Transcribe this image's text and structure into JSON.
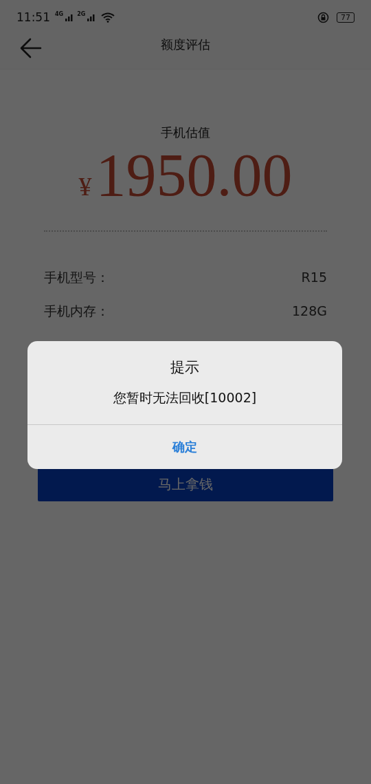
{
  "status_bar": {
    "time": "11:51",
    "signal_1": "4G",
    "signal_2": "2G",
    "battery": "77"
  },
  "header": {
    "title": "额度评估"
  },
  "valuation": {
    "label": "手机估值",
    "currency": "¥",
    "amount": "1950.00"
  },
  "specs": [
    {
      "label": "手机型号：",
      "value": "R15"
    },
    {
      "label": "手机内存：",
      "value": "128G"
    }
  ],
  "submit_button": {
    "label": "马上拿钱"
  },
  "dialog": {
    "title": "提示",
    "message": "您暂时无法回收[10002]",
    "confirm": "确定"
  }
}
